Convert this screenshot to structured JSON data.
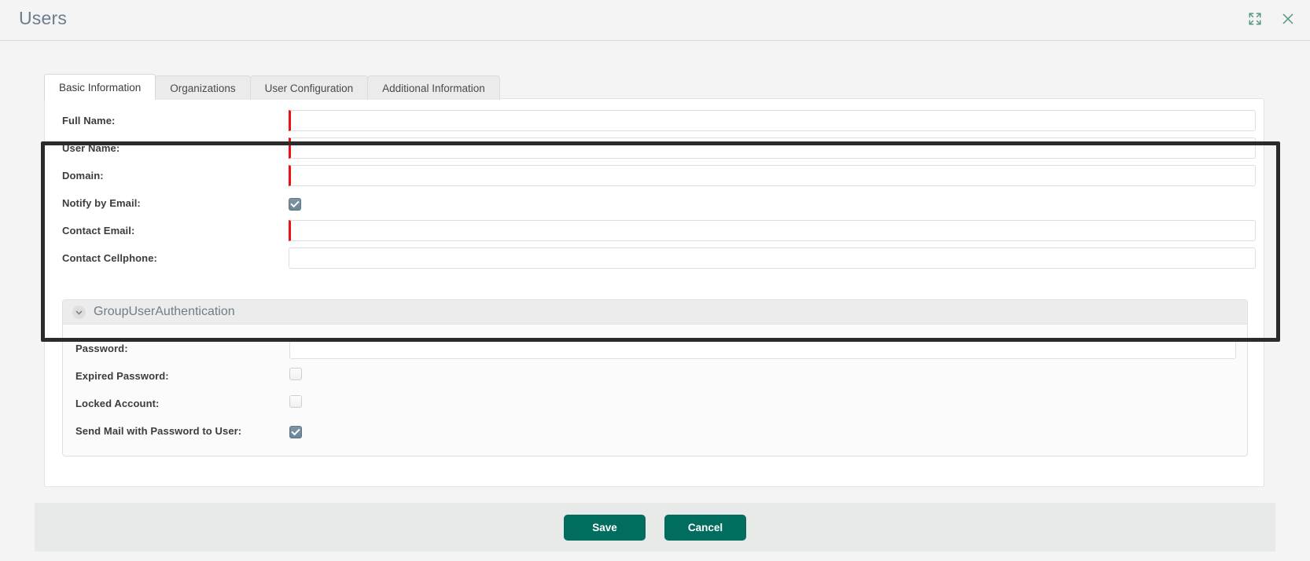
{
  "window": {
    "title": "Users",
    "expand_icon": "expand-icon",
    "close_icon": "close-icon"
  },
  "tabs": [
    {
      "label": "Basic Information",
      "active": true
    },
    {
      "label": "Organizations",
      "active": false
    },
    {
      "label": "User Configuration",
      "active": false
    },
    {
      "label": "Additional Information",
      "active": false
    }
  ],
  "basic_information": {
    "fields": [
      {
        "label": "Full Name:",
        "type": "text",
        "value": "",
        "placeholder": "",
        "required": true
      },
      {
        "label": "User Name:",
        "type": "text",
        "value": "",
        "placeholder": "",
        "required": true
      },
      {
        "label": "Domain:",
        "type": "text",
        "value": "",
        "placeholder": "",
        "required": true
      },
      {
        "label": "Notify by Email:",
        "type": "checkbox",
        "checked": true,
        "required": false
      },
      {
        "label": "Contact Email:",
        "type": "text",
        "value": "",
        "placeholder": "",
        "required": true
      },
      {
        "label": "Contact Cellphone:",
        "type": "text",
        "value": "",
        "placeholder": "",
        "required": false
      }
    ]
  },
  "group_section": {
    "title": "GroupUserAuthentication",
    "collapse_icon": "chevron-down-icon",
    "expanded": true,
    "fields": [
      {
        "label": "Password:",
        "type": "text",
        "value": "",
        "placeholder": "",
        "required": false
      },
      {
        "label": "Expired Password:",
        "type": "checkbox",
        "checked": false,
        "required": false
      },
      {
        "label": "Locked Account:",
        "type": "checkbox",
        "checked": false,
        "required": false
      },
      {
        "label": "Send Mail with Password to User:",
        "type": "checkbox",
        "checked": true,
        "required": false
      }
    ]
  },
  "footer": {
    "save_label": "Save",
    "cancel_label": "Cancel"
  },
  "colors": {
    "accent_teal": "#006d5e",
    "icon_teal": "#4e9480",
    "required_red": "#ef1111",
    "checkbox_checked": "#6d8595",
    "title_text": "#6b7d8c",
    "highlight_border": "#2b2b2b",
    "footer_bg": "#e8eae9",
    "page_bg": "#f4f4f4"
  }
}
